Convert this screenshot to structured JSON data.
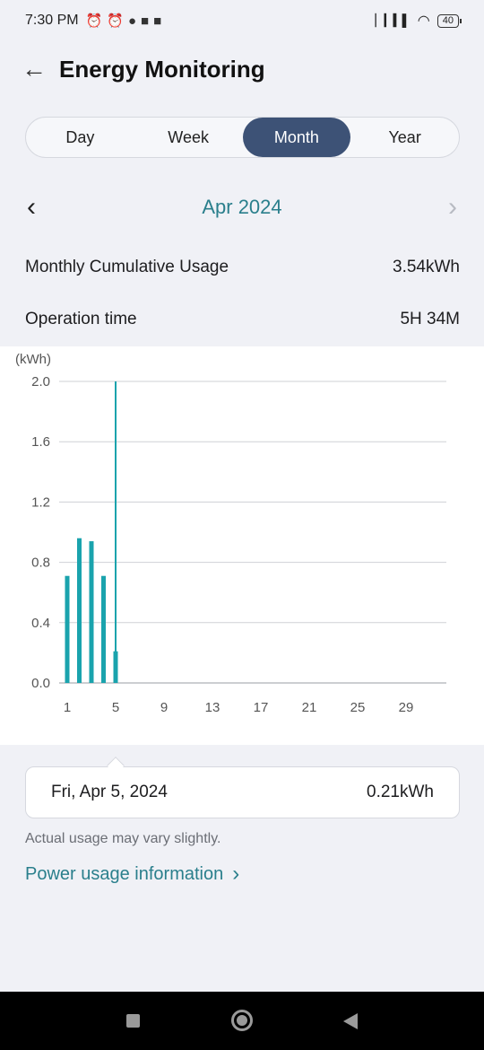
{
  "status_bar": {
    "time": "7:30 PM",
    "icons": [
      "mute-alarm-icon",
      "alarm-icon",
      "chat-icon",
      "app-icon",
      "app-icon"
    ],
    "battery": "40"
  },
  "header": {
    "title": "Energy Monitoring",
    "back_icon": "back-arrow-icon"
  },
  "tabs": [
    {
      "label": "Day",
      "active": false
    },
    {
      "label": "Week",
      "active": false
    },
    {
      "label": "Month",
      "active": true
    },
    {
      "label": "Year",
      "active": false
    }
  ],
  "period": {
    "label": "Apr 2024"
  },
  "stats": {
    "usage_label": "Monthly Cumulative Usage",
    "usage_value": "3.54kWh",
    "time_label": "Operation time",
    "time_value": "5H 34M"
  },
  "chart_data": {
    "type": "bar",
    "ylabel": "(kWh)",
    "ylim": [
      0,
      2.0
    ],
    "yticks": [
      "2.0",
      "1.6",
      "1.2",
      "0.8",
      "0.4",
      "0.0"
    ],
    "xticks": [
      "1",
      "5",
      "9",
      "13",
      "17",
      "21",
      "25",
      "29"
    ],
    "categories": [
      1,
      2,
      3,
      4,
      5
    ],
    "values": [
      0.71,
      0.96,
      0.94,
      0.71,
      0.21
    ],
    "selected_day": 5,
    "bar_color": "#1aa3ad",
    "grid": true
  },
  "detail": {
    "date": "Fri, Apr 5, 2024",
    "value": "0.21kWh"
  },
  "note": "Actual usage may vary slightly.",
  "power_link": "Power usage information",
  "colors": {
    "accent": "#2a7f8c",
    "active_tab": "#3d5276",
    "bar": "#1aa3ad"
  }
}
